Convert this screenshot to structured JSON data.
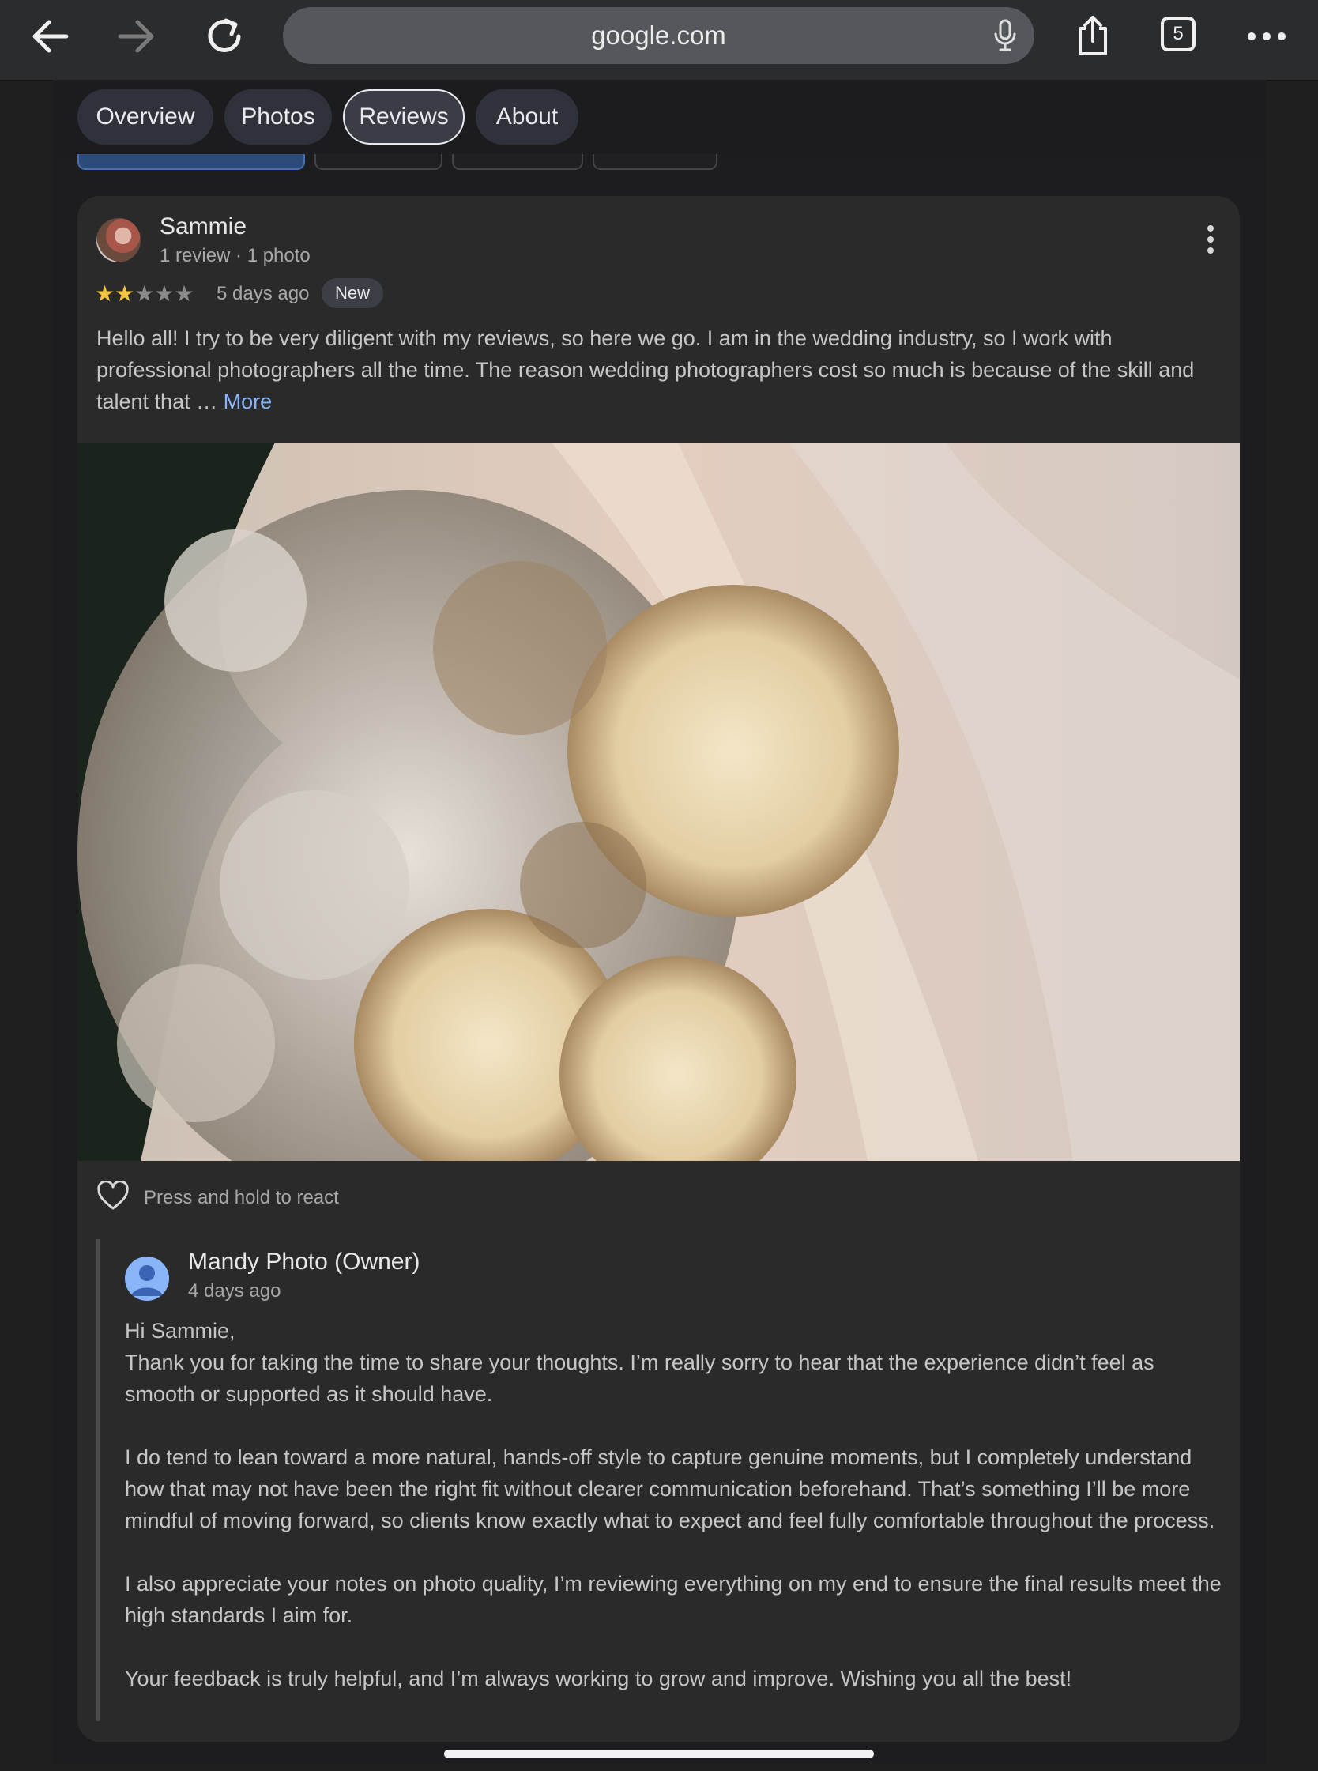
{
  "browser": {
    "url": "google.com",
    "tab_count": "5",
    "icons": [
      "back-arrow-icon",
      "forward-arrow-icon",
      "reload-icon",
      "mic-icon",
      "share-icon",
      "tabs-icon",
      "more-icon"
    ]
  },
  "tabs": [
    {
      "label": "Overview"
    },
    {
      "label": "Photos"
    },
    {
      "label": "Reviews",
      "active": true
    },
    {
      "label": "About"
    }
  ],
  "review": {
    "author": "Sammie",
    "author_meta": "1 review · 1 photo",
    "rating": 2,
    "rating_max": 5,
    "time": "5 days ago",
    "badge": "New",
    "text": "Hello all! I try to be very diligent with my reviews, so here we go. I am in the wedding industry, so I work with professional photographers all the time. The reason wedding photographers cost so much is because of the skill and talent that …",
    "more_label": "More",
    "react_hint": "Press and hold to react"
  },
  "owner_reply": {
    "author": "Mandy Photo (Owner)",
    "time": "4 days ago",
    "paragraphs": [
      "Hi Sammie,\nThank you for taking the time to share your thoughts. I’m really sorry to hear that the experience didn’t feel as smooth or supported as it should have.",
      "I do tend to lean toward a more natural, hands-off style to capture genuine moments, but I completely understand how that may not have been the right fit without clearer communication beforehand. That’s something I’ll be more mindful of moving forward, so clients know exactly what to expect and feel fully comfortable throughout the process.",
      "I also appreciate your notes on photo quality, I’m reviewing everything on my end to ensure the final results meet the high standards I aim for.",
      "Your feedback is truly helpful, and I’m always working to grow and improve. Wishing you all the best!"
    ]
  },
  "colors": {
    "accent_link": "#8ab4f8",
    "star_filled": "#f4c542",
    "star_empty": "#8b8b8b"
  }
}
